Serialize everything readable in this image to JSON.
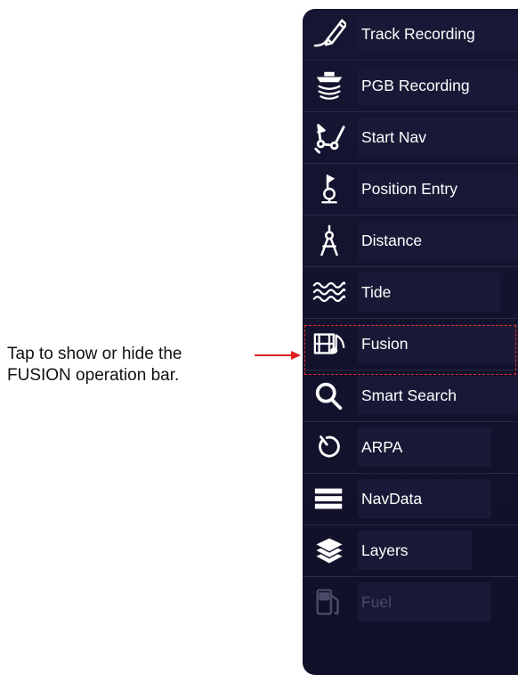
{
  "callout": {
    "line1": "Tap to show or hide the",
    "line2": "FUSION operation bar."
  },
  "colors": {
    "menu_bg": "#12122c",
    "accent_red": "#e02020",
    "text": "#ffffff",
    "disabled_text": "#4a4a66"
  },
  "menu": {
    "items": [
      {
        "label": "Track Recording",
        "icon": "pen-track-icon",
        "disabled": false
      },
      {
        "label": "PGB Recording",
        "icon": "boat-sonar-icon",
        "disabled": false
      },
      {
        "label": "Start Nav",
        "icon": "route-icon",
        "disabled": false
      },
      {
        "label": "Position Entry",
        "icon": "position-pin-icon",
        "disabled": false
      },
      {
        "label": "Distance",
        "icon": "compass-divider-icon",
        "disabled": false
      },
      {
        "label": "Tide",
        "icon": "waves-icon",
        "disabled": false
      },
      {
        "label": "Fusion",
        "icon": "film-music-icon",
        "disabled": false
      },
      {
        "label": "Smart Search",
        "icon": "search-icon",
        "disabled": false
      },
      {
        "label": "ARPA",
        "icon": "arpa-target-icon",
        "disabled": false
      },
      {
        "label": "NavData",
        "icon": "menu-bars-icon",
        "disabled": false
      },
      {
        "label": "Layers",
        "icon": "layers-icon",
        "disabled": false
      },
      {
        "label": "Fuel",
        "icon": "fuel-pump-icon",
        "disabled": true
      }
    ]
  }
}
